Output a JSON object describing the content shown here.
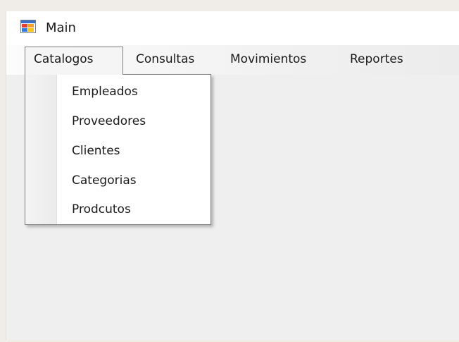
{
  "window": {
    "title": "Main",
    "icon": "windows-form-icon"
  },
  "menubar": {
    "items": [
      {
        "label": "Catalogos",
        "open": true
      },
      {
        "label": "Consultas"
      },
      {
        "label": "Movimientos"
      },
      {
        "label": "Reportes"
      }
    ]
  },
  "dropdown": {
    "items": [
      {
        "label": "Empleados"
      },
      {
        "label": "Proveedores"
      },
      {
        "label": "Clientes"
      },
      {
        "label": "Categorias"
      },
      {
        "label": "Prodcutos"
      }
    ]
  }
}
